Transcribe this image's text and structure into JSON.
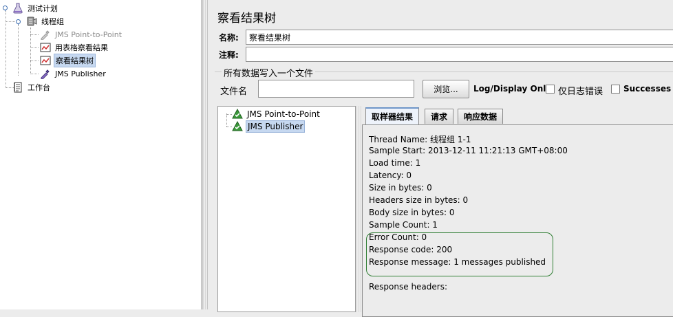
{
  "left_tree": {
    "items": [
      {
        "label": "测试计划",
        "icon": "flask-icon"
      },
      {
        "label": "线程组",
        "icon": "thread-group-icon"
      },
      {
        "label": "JMS Point-to-Point",
        "icon": "sampler-pipette-icon",
        "disabled": true
      },
      {
        "label": "用表格察看结果",
        "icon": "listener-graph-icon"
      },
      {
        "label": "察看结果树",
        "icon": "listener-graph-icon",
        "selected": true
      },
      {
        "label": "JMS Publisher",
        "icon": "sampler-pipette-icon"
      },
      {
        "label": "工作台",
        "icon": "workbench-icon"
      }
    ]
  },
  "panel": {
    "title": "察看结果树",
    "name_label": "名称:",
    "name_value": "察看结果树",
    "comment_label": "注释:",
    "comment_value": "",
    "file_group_title": "所有数据写入一个文件",
    "filename_label": "文件名",
    "filename_value": "",
    "browse_label": "浏览...",
    "log_display_label": "Log/Display Only:",
    "errors_only_label": "仅日志错误",
    "successes_label": "Successes"
  },
  "result_tree": {
    "items": [
      {
        "label": "JMS Point-to-Point",
        "status": "success"
      },
      {
        "label": "JMS Publisher",
        "status": "success",
        "selected": true
      }
    ]
  },
  "tabs": [
    {
      "label": "取样器结果",
      "active": true
    },
    {
      "label": "请求"
    },
    {
      "label": "响应数据"
    }
  ],
  "sampler_result": {
    "lines": [
      "Thread Name: 线程组 1-1",
      "Sample Start: 2013-12-11 11:21:13 GMT+08:00",
      "Load time: 1",
      "Latency: 0",
      "Size in bytes: 0",
      "Headers size in bytes: 0",
      "Body size in bytes: 0",
      "Sample Count: 1",
      "Error Count: 0",
      "Response code: 200",
      "Response message: 1 messages published",
      "",
      "Response headers:"
    ]
  },
  "colors": {
    "highlight": "#2e7d32",
    "selection": "#c6d8f0",
    "success_icon": "#2e8b2e"
  }
}
